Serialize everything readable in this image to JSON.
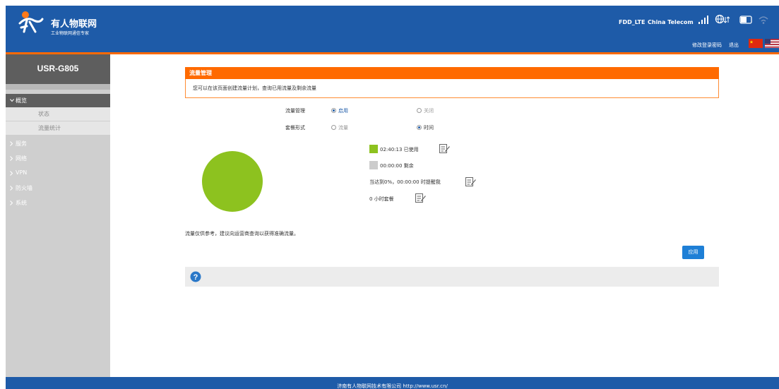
{
  "header": {
    "brand_title": "有人物联网",
    "brand_subtitle": "工业物联网通信专家",
    "network_type": "FDD_LTE",
    "carrier": "China Telecom",
    "change_password": "修改登录密码",
    "logout": "退出"
  },
  "sidebar": {
    "device_name": "USR-G805",
    "active_item": "概览",
    "sub_items": [
      "状态",
      "流量统计"
    ],
    "items": [
      "服务",
      "网络",
      "VPN",
      "防火墙",
      "系统"
    ]
  },
  "section": {
    "title": "流量管理",
    "description": "您可以在该页面创建流量计划，查询已用流量及剩余流量"
  },
  "form": {
    "traffic_mgmt_label": "流量管理",
    "enable_label": "启用",
    "disable_label": "关闭",
    "package_label": "套餐形式",
    "traffic_option": "流量",
    "time_option": "时间",
    "traffic_mgmt_value": "启用",
    "package_value": "时间"
  },
  "usage": {
    "used_text": "02:40:13 已使用",
    "remaining_text": "00:00:00 剩余",
    "alert_text": "当达到0%，00:00:00 时提醒我",
    "plan_text": "0 小时套餐",
    "used_color": "#8dc21f",
    "remaining_color": "#cccccc"
  },
  "chart_data": {
    "type": "pie",
    "slices": [
      {
        "label": "已使用",
        "value": 100,
        "color": "#8dc21f"
      },
      {
        "label": "剩余",
        "value": 0,
        "color": "#cccccc"
      }
    ]
  },
  "note": "流量仅供参考，建议向运营商查询以获得准确流量。",
  "apply_button": "应用",
  "footer": "济南有人物联网技术有限公司 http://www.usr.cn/",
  "colors": {
    "header_blue": "#1e5ba8",
    "accent_orange": "#ff6a00",
    "button_blue": "#1e7fd6"
  },
  "icons": [
    "signal-icon",
    "globe-icon",
    "sim-icon",
    "wifi-icon",
    "edit-icon",
    "help-icon"
  ]
}
